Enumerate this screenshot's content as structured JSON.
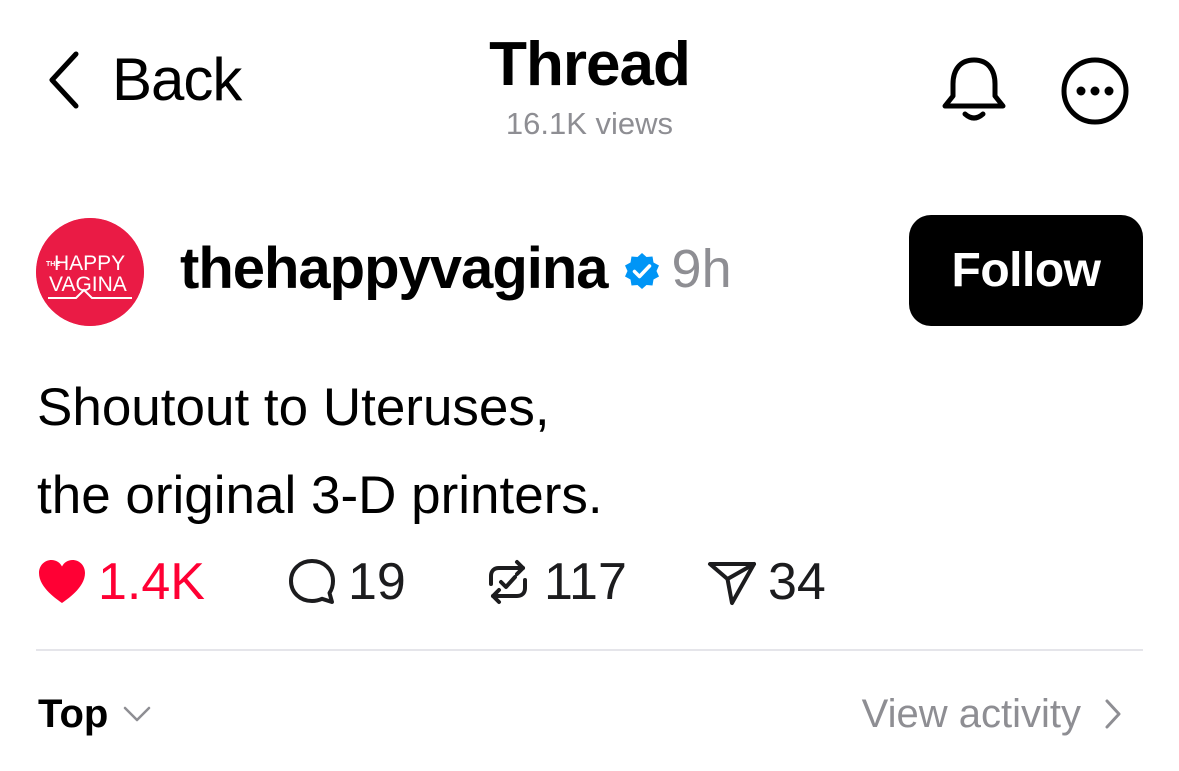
{
  "header": {
    "back_label": "Back",
    "title": "Thread",
    "views": "16.1K views",
    "bell_icon": "bell-icon",
    "more_icon": "more-options-icon"
  },
  "post": {
    "avatar_text_line1": "HAPPY",
    "avatar_text_line2": "VAGINA",
    "avatar_text_prefix": "THE",
    "avatar_color": "#ea1b45",
    "username": "thehappyvagina",
    "verified": true,
    "verified_color": "#0095f6",
    "time": "9h",
    "follow_label": "Follow",
    "text_lines": [
      "Shoutout to Uteruses,",
      "the original 3-D printers."
    ]
  },
  "actions": {
    "likes": "1.4K",
    "replies": "19",
    "reposts": "117",
    "shares": "34",
    "like_color": "#ff0034"
  },
  "footer": {
    "sort_label": "Top",
    "activity_label": "View activity"
  }
}
